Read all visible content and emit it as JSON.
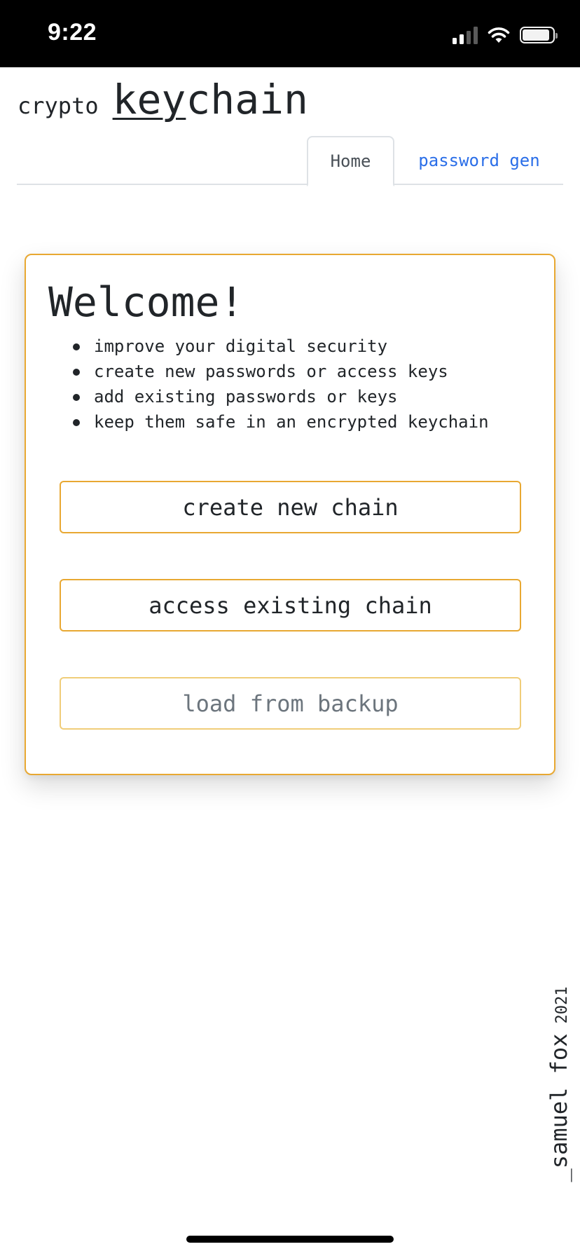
{
  "status_bar": {
    "time": "9:22",
    "icons": [
      "cellular-signal-icon",
      "wifi-icon",
      "battery-icon"
    ],
    "background": "#000000"
  },
  "brand": {
    "prefix": "crypto",
    "title_underlined": "key",
    "title_rest": "chain"
  },
  "tabs": [
    {
      "label": "Home",
      "active": true
    },
    {
      "label": "password gen",
      "active": false
    }
  ],
  "welcome": {
    "title": "Welcome!",
    "features": [
      "improve your digital security",
      "create new passwords or access keys",
      "add existing passwords or keys",
      "keep them safe in an encrypted keychain"
    ],
    "buttons": {
      "create": "create new chain",
      "access": "access existing chain",
      "backup": "load from backup"
    }
  },
  "credit": {
    "name": "_samuel fox",
    "year": "2021"
  },
  "colors": {
    "accent": "#e8a832",
    "accent_light": "#f0cd79",
    "link": "#2a6ee8",
    "text": "#212529",
    "muted": "#6c757d"
  }
}
